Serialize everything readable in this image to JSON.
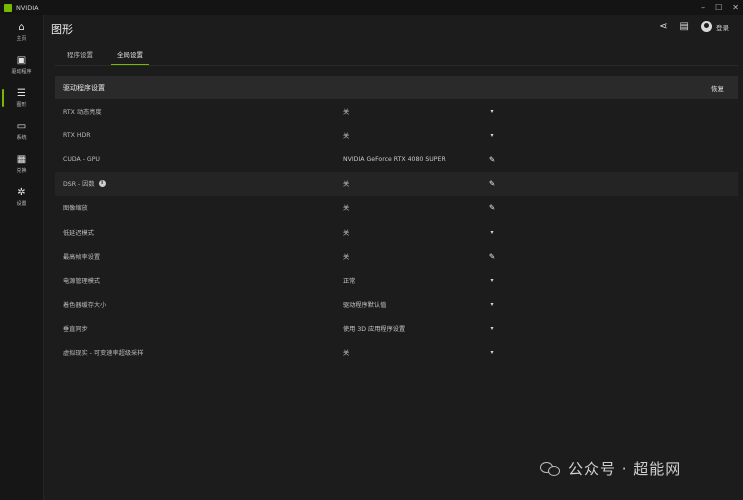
{
  "app": {
    "name": "NVIDIA",
    "window_controls": [
      "–",
      "☐",
      "✕"
    ]
  },
  "sidebar": {
    "items": [
      {
        "icon": "home-icon",
        "glyph": "⌂",
        "label": "主页"
      },
      {
        "icon": "driver-icon",
        "glyph": "▣",
        "label": "驱动程序"
      },
      {
        "icon": "graphics-icon",
        "glyph": "☰",
        "label": "图形",
        "active": true
      },
      {
        "icon": "system-icon",
        "glyph": "▭",
        "label": "系统"
      },
      {
        "icon": "redeem-icon",
        "glyph": "▦",
        "label": "兑换"
      },
      {
        "icon": "settings-icon",
        "glyph": "✲",
        "label": "设置"
      }
    ]
  },
  "header": {
    "title": "图形",
    "share_glyph": "⋖",
    "feedback_glyph": "▤",
    "login_label": "登录"
  },
  "tabs": [
    {
      "label": "程序设置",
      "active": false
    },
    {
      "label": "全局设置",
      "active": true
    }
  ],
  "panel": {
    "title": "驱动程序设置",
    "restore_label": "恢复",
    "rows": [
      {
        "name": "RTX 动态亮度",
        "value": "关",
        "control": "dropdown",
        "glyph": "▾"
      },
      {
        "name": "RTX HDR",
        "value": "关",
        "control": "dropdown",
        "glyph": "▾"
      },
      {
        "name": "CUDA - GPU",
        "value": "NVIDIA GeForce RTX 4080 SUPER",
        "control": "edit",
        "glyph": "✎"
      },
      {
        "name": "DSR - 因数",
        "value": "关",
        "control": "edit",
        "glyph": "✎",
        "info": "i",
        "highlighted": true
      },
      {
        "name": "图像缩放",
        "value": "关",
        "control": "edit",
        "glyph": "✎"
      },
      {
        "name": "低延迟模式",
        "value": "关",
        "control": "dropdown",
        "glyph": "▾"
      },
      {
        "name": "最高帧率设置",
        "value": "关",
        "control": "edit",
        "glyph": "✎"
      },
      {
        "name": "电源管理模式",
        "value": "正常",
        "control": "dropdown",
        "glyph": "▾"
      },
      {
        "name": "着色器缓存大小",
        "value": "驱动程序默认值",
        "control": "dropdown",
        "glyph": "▾"
      },
      {
        "name": "垂直同步",
        "value": "使用 3D 应用程序设置",
        "control": "dropdown",
        "glyph": "▾"
      },
      {
        "name": "虚拟现实 - 可变速率超级采样",
        "value": "关",
        "control": "dropdown",
        "glyph": "▾"
      }
    ]
  },
  "watermark": {
    "text": "公众号 · 超能网"
  },
  "colors": {
    "accent": "#76b900",
    "background": "#1c1c1c",
    "panel_header": "#2a2a2a"
  }
}
